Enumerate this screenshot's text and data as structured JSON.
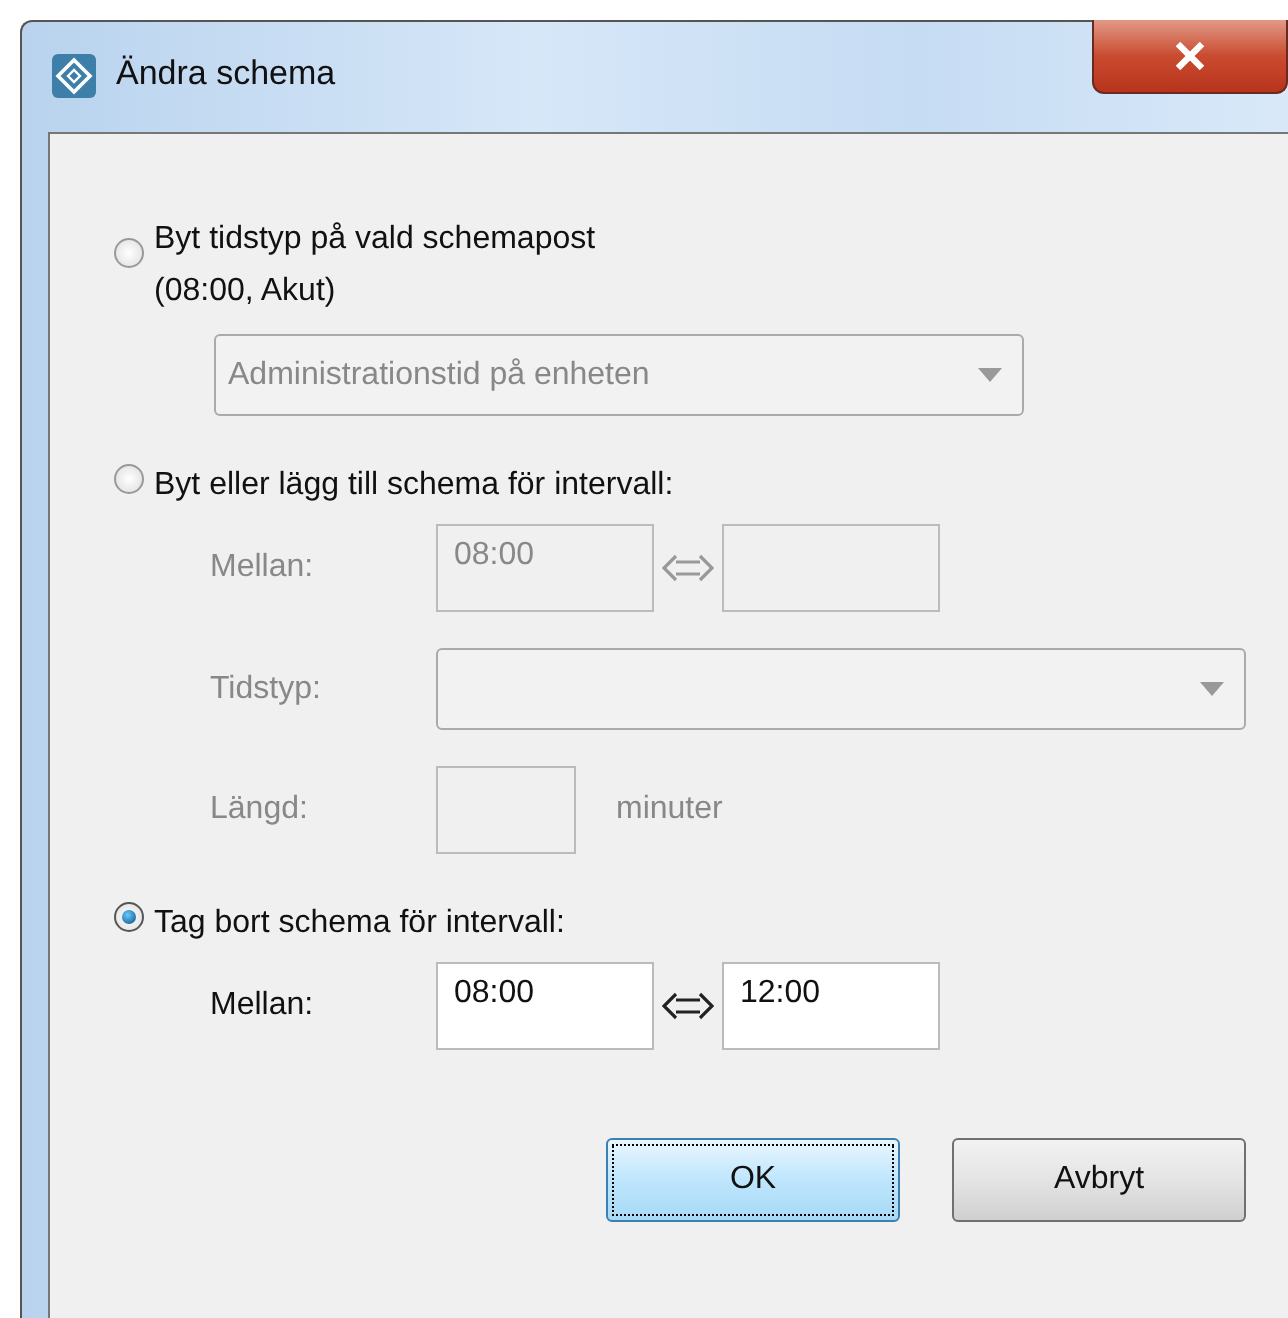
{
  "window": {
    "title": "Ändra schema"
  },
  "options": [
    {
      "kind": "type-change",
      "label": "Byt tidstyp på vald schemapost",
      "sublabel": "(08:00, Akut)",
      "selected": false,
      "dropdown": {
        "value": "Administrationstid på enheten",
        "disabled": true
      }
    },
    {
      "kind": "interval",
      "label": "Byt eller lägg till schema för intervall:",
      "selected": false,
      "disabled": true,
      "between": {
        "label": "Mellan:",
        "from": "08:00"
      },
      "type_field": {
        "label": "Tidstyp:"
      },
      "length": {
        "label": "Längd:",
        "unit": "minuter"
      }
    },
    {
      "kind": "interval",
      "label": "Tag bort schema för intervall:",
      "selected": true,
      "disabled": false,
      "between": {
        "label": "Mellan:",
        "from": "08:00",
        "to": "12:00"
      }
    }
  ],
  "buttons": [
    {
      "label": "OK",
      "default": true
    },
    {
      "label": "Avbryt",
      "default": false
    }
  ]
}
